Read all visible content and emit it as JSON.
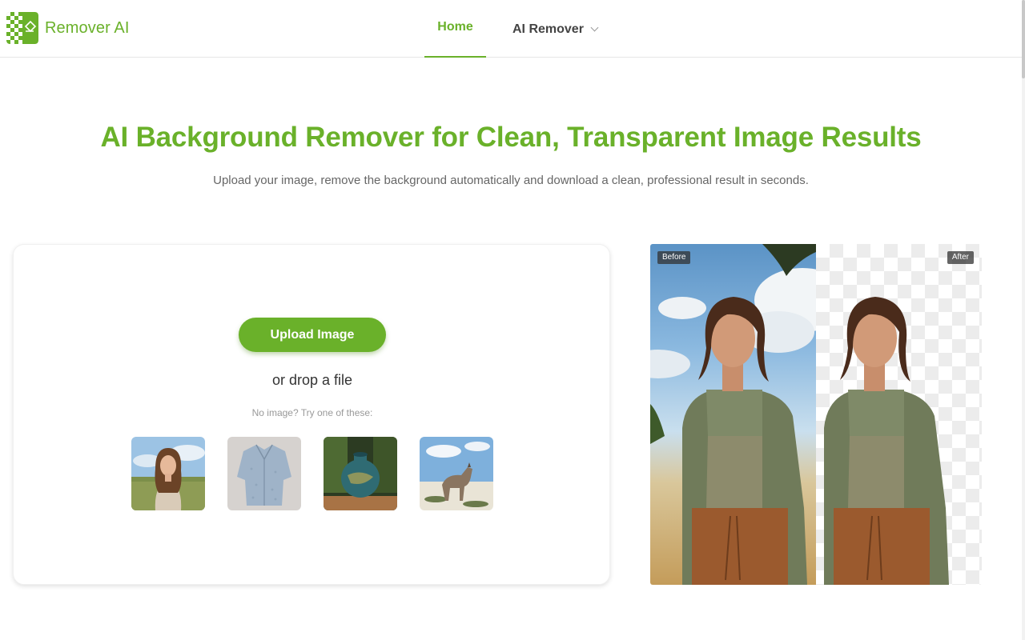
{
  "brand": {
    "name": "Remover AI",
    "accent_color": "#6ab12a",
    "logo_icon": "checkerboard-eraser-icon"
  },
  "nav": {
    "home_label": "Home",
    "ai_remover_label": "AI Remover",
    "dropdown_icon": "chevron-down-icon"
  },
  "hero": {
    "title": "AI Background Remover for Clean, Transparent Image Results",
    "subtitle": "Upload your image, remove the background automatically and download a clean, professional result in seconds."
  },
  "upload": {
    "button_label": "Upload Image",
    "drop_text": "or drop a file",
    "samples_prompt": "No image? Try one of these:",
    "samples": [
      {
        "name": "sample-woman-field"
      },
      {
        "name": "sample-shirt"
      },
      {
        "name": "sample-vase"
      },
      {
        "name": "sample-wolf"
      }
    ]
  },
  "compare": {
    "before_label": "Before",
    "after_label": "After"
  }
}
